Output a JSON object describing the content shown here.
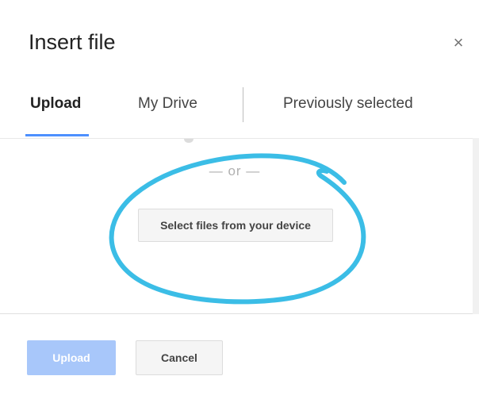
{
  "dialog": {
    "title": "Insert file",
    "close_symbol": "×"
  },
  "tabs": [
    {
      "label": "Upload",
      "active": true
    },
    {
      "label": "My Drive",
      "active": false
    },
    {
      "label": "Previously selected",
      "active": false
    }
  ],
  "content": {
    "or_text": "— or —",
    "select_button_label": "Select files from your device"
  },
  "footer": {
    "upload_label": "Upload",
    "cancel_label": "Cancel"
  },
  "colors": {
    "accent": "#4d90fe",
    "annotation": "#3bbde6",
    "upload_disabled": "#a8c7fa"
  },
  "icons": {
    "close": "close-icon"
  }
}
